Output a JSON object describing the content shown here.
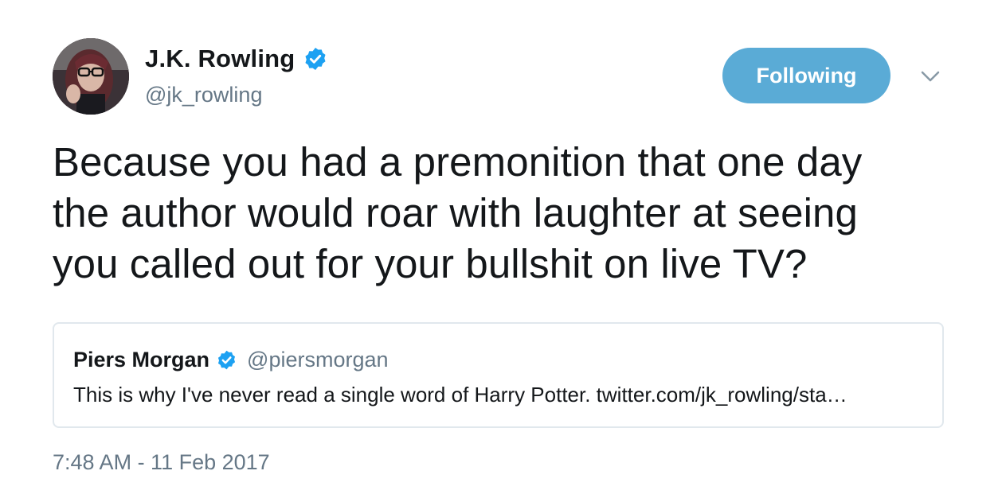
{
  "author": {
    "display_name": "J.K. Rowling",
    "handle": "@jk_rowling",
    "verified_icon": "verified-badge-icon",
    "avatar_icon": "profile-photo-avatar"
  },
  "follow_button": {
    "label": "Following",
    "color": "#5aabd6"
  },
  "menu": {
    "icon": "chevron-down-icon"
  },
  "tweet": {
    "text_lines": [
      "Because you had a premonition that one day",
      "the author would roar with laughter at seeing",
      "you called out for your bullshit on live TV?"
    ],
    "timestamp": "7:48 AM - 11 Feb 2017"
  },
  "quoted_tweet": {
    "display_name": "Piers Morgan",
    "handle": "@piersmorgan",
    "text": "This is why I've never read a single word of Harry Potter. twitter.com/jk_rowling/sta…"
  },
  "colors": {
    "text": "#14171a",
    "secondary": "#657786",
    "verified": "#1da1f2",
    "border": "#e1e8ed"
  }
}
